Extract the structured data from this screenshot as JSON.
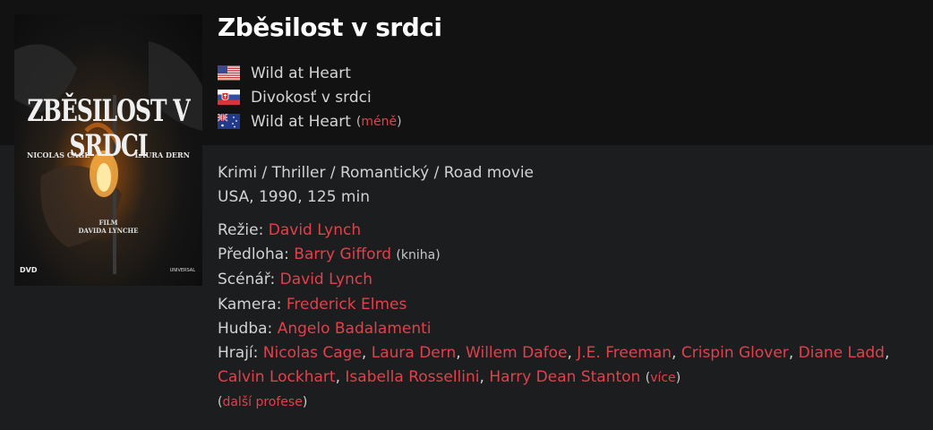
{
  "movie": {
    "title": "Zběsilost v srdci",
    "alt_titles": [
      {
        "flag": "us-flag-icon",
        "name": "Wild at Heart"
      },
      {
        "flag": "sk-flag-icon",
        "name": "Divokosť v srdci"
      },
      {
        "flag": "au-flag-icon",
        "name": "Wild at Heart"
      }
    ],
    "less_label": "méně",
    "genres": "Krimi / Thriller / Romantický / Road movie",
    "origin": "USA, 1990, 125 min"
  },
  "poster": {
    "title": "ZBĚSILOST V SRDCI",
    "actor_left": "NICOLAS CAGE",
    "actor_right": "LAURA DERN",
    "credit_line1": "FILM",
    "credit_line2": "DAVIDA LYNCHE",
    "dvd": "DVD",
    "studio": "UNIVERSAL"
  },
  "credits": {
    "directing_label": "Režie:",
    "directing": [
      "David Lynch"
    ],
    "source_label": "Předloha:",
    "source": [
      "Barry Gifford"
    ],
    "source_note": "(kniha)",
    "screenplay_label": "Scénář:",
    "screenplay": [
      "David Lynch"
    ],
    "camera_label": "Kamera:",
    "camera": [
      "Frederick Elmes"
    ],
    "music_label": "Hudba:",
    "music": [
      "Angelo Badalamenti"
    ],
    "cast_label": "Hrají:",
    "cast": [
      "Nicolas Cage",
      "Laura Dern",
      "Willem Dafoe",
      "J.E. Freeman",
      "Crispin Glover",
      "Diane Ladd",
      "Calvin Lockhart",
      "Isabella Rossellini",
      "Harry Dean Stanton"
    ],
    "more_label": "více",
    "more_professions_label": "další profese"
  },
  "colors": {
    "link": "#e0414b",
    "background": "#1c1d1f",
    "header_band": "#121212"
  }
}
